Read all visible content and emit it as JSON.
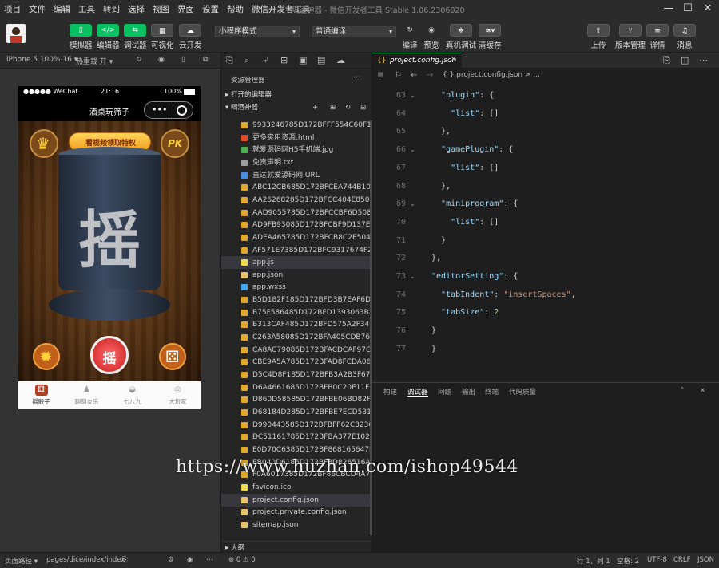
{
  "menu": [
    "项目",
    "文件",
    "编辑",
    "工具",
    "转到",
    "选择",
    "视图",
    "界面",
    "设置",
    "帮助",
    "微信开发者工具"
  ],
  "window_title": "喝酒神器 - 微信开发者工具 Stable 1.06.2306020",
  "toolbar": {
    "simulator": "模拟器",
    "editor": "编辑器",
    "debugger": "调试器",
    "visual": "可视化",
    "cloud": "云开发",
    "mode_select": "小程序模式",
    "compile_select": "普通编译",
    "compile": "编译",
    "preview": "预览",
    "real_debug": "真机调试",
    "clear_cache": "清缓存",
    "upload": "上传",
    "version": "版本管理",
    "details": "详情",
    "messages": "消息"
  },
  "sim": {
    "device": "iPhone 5 100% 16 ▾",
    "hot_reload": "热重载 开 ▾",
    "status_left": "●●●●● WeChat",
    "status_time": "21:16",
    "status_battery": "100%",
    "page_title": "酒桌玩筛子",
    "capsule_dots": "•••",
    "video_btn": "看视频领取特权",
    "pk": "PK",
    "dice_char": "摇",
    "shake_btn": "摇",
    "tabs": [
      "摇骰子",
      "翻翻友乐",
      "七八九",
      "大玩家"
    ]
  },
  "explorer": {
    "title": "资源管理器",
    "open_editors": "打开的编辑器",
    "project": "喝酒神器",
    "outline": "大纲",
    "files": [
      {
        "name": "9933246785D172BFFF554C60F1FF6...",
        "type": "img"
      },
      {
        "name": "更多实用资源.html",
        "type": "html"
      },
      {
        "name": "就爱源码网H5手机端.jpg",
        "type": "jpg"
      },
      {
        "name": "免责声明.txt",
        "type": "txt"
      },
      {
        "name": "直达就爱源码网.URL",
        "type": "url"
      },
      {
        "name": "ABC12CB685D172BFCEA744B10A9...",
        "type": "img"
      },
      {
        "name": "AA26268285D172BFCC404E850991...",
        "type": "img"
      },
      {
        "name": "AAD9055785D172BFCCBF6D50892...",
        "type": "img"
      },
      {
        "name": "AD9FB93085D172BFCBF9D137ED6...",
        "type": "img"
      },
      {
        "name": "ADEA465785D172BFCB8C2E50423...",
        "type": "img"
      },
      {
        "name": "AF571E7385D172BFC9317674F241...",
        "type": "img"
      },
      {
        "name": "app.js",
        "type": "js"
      },
      {
        "name": "app.json",
        "type": "json"
      },
      {
        "name": "app.wxss",
        "type": "wxss"
      },
      {
        "name": "B5D182F185D172BFD3B7EAF6D831...",
        "type": "img"
      },
      {
        "name": "B75F586485D172BFD1393063B230...",
        "type": "img"
      },
      {
        "name": "B313CAF485D172BFD575A2F34920...",
        "type": "img"
      },
      {
        "name": "C263A58085D172BFA405CDB76D4...",
        "type": "img"
      },
      {
        "name": "CA8AC79085D172BFACDCAF97CB7...",
        "type": "img"
      },
      {
        "name": "CBE9A5A785D172BFAD8FCDA0618...",
        "type": "img"
      },
      {
        "name": "D5C4D8F185D172BFB3A2B3F677D...",
        "type": "img"
      },
      {
        "name": "D6A4661685D172BFB0C20E11F600...",
        "type": "img"
      },
      {
        "name": "D860D58585D172BFBE06BD82F7B1...",
        "type": "img"
      },
      {
        "name": "D68184D285D172BFBE7ECD531F...",
        "type": "img"
      },
      {
        "name": "D990443585D172BFBFF62C323CA0...",
        "type": "img"
      },
      {
        "name": "DC51161785D172BFBA377E102D5...",
        "type": "img"
      },
      {
        "name": "E0D70C6385D172BF868165647F0...",
        "type": "img"
      },
      {
        "name": "EB040D6185D172BF8D826516A4E...",
        "type": "img"
      },
      {
        "name": "F0A6017385D172BF86CBCD4A74...",
        "type": "img"
      },
      {
        "name": "favicon.ico",
        "type": "ico"
      },
      {
        "name": "project.config.json",
        "type": "json"
      },
      {
        "name": "project.private.config.json",
        "type": "json"
      },
      {
        "name": "sitemap.json",
        "type": "json"
      }
    ]
  },
  "editor": {
    "tab": "project.config.json",
    "breadcrumb": "{ } project.config.json > ...",
    "line_numbers": [
      "63",
      "64",
      "65",
      "66",
      "67",
      "68",
      "69",
      "70",
      "71",
      "72",
      "73",
      "74",
      "75",
      "76",
      "77"
    ],
    "lines": [
      "  \"plugin\": {",
      "    \"list\": []",
      "  },",
      "  \"gamePlugin\": {",
      "    \"list\": []",
      "  },",
      "  \"miniprogram\": {",
      "    \"list\": []",
      "  }",
      "},",
      "\"editorSetting\": {",
      "  \"tabIndent\": \"insertSpaces\",",
      "  \"tabSize\": 2",
      "}",
      "}"
    ]
  },
  "panel": {
    "tabs": [
      "构建",
      "调试器",
      "问题",
      "输出",
      "终端",
      "代码质量"
    ]
  },
  "status": {
    "page_path_label": "页面路径 ▾",
    "page_path": "pages/dice/index/index",
    "errors": "⊗ 0 ⚠ 0",
    "position": "行 1，列 1",
    "spaces": "空格: 2",
    "encoding": "UTF-8",
    "eol": "CRLF",
    "lang": "JSON"
  },
  "watermark": "https://www.huzhan.com/ishop49544"
}
